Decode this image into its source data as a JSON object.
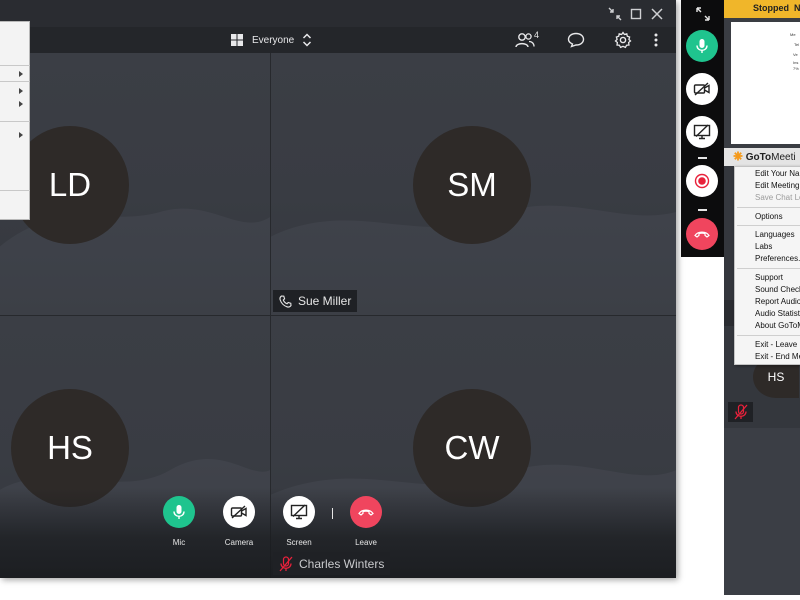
{
  "toolbar": {
    "view_label": "Everyone",
    "participant_count": "4"
  },
  "participants": [
    {
      "initials": "LD",
      "name": ""
    },
    {
      "initials": "SM",
      "name": "Sue Miller"
    },
    {
      "initials": "HS",
      "name": ""
    },
    {
      "initials": "CW",
      "name": "Charles Winters"
    }
  ],
  "controls": {
    "mic": "Mic",
    "camera": "Camera",
    "screen": "Screen",
    "leave": "Leave"
  },
  "colors": {
    "mic_active": "#1fc48e",
    "leave": "#f0455e",
    "record": "#e8213b",
    "status_bar": "#f0b62a",
    "logo_accent": "#f59a1b"
  },
  "goto": {
    "status": "Stopped",
    "status_extra": "N",
    "app_name_prefix": "GoTo",
    "app_name_suffix": "Meeti",
    "menu": [
      {
        "label": "Edit Your Na",
        "disabled": false
      },
      {
        "label": "Edit Meeting",
        "disabled": false
      },
      {
        "label": "Save Chat Lo",
        "disabled": true
      },
      {
        "label": "Options",
        "disabled": false
      },
      {
        "label": "Languages",
        "disabled": false
      },
      {
        "label": "Labs",
        "disabled": false
      },
      {
        "label": "Preferences...",
        "disabled": false
      },
      {
        "label": "Support",
        "disabled": false
      },
      {
        "label": "Sound Check",
        "disabled": false
      },
      {
        "label": "Report Audio",
        "disabled": false
      },
      {
        "label": "Audio Statist",
        "disabled": false
      },
      {
        "label": "About GoToM",
        "disabled": false
      },
      {
        "label": "Exit - Leave M",
        "disabled": false
      },
      {
        "label": "Exit - End Me",
        "disabled": false
      }
    ],
    "thumb_initials": "HS",
    "slide_lines": [
      "Me",
      "Tel",
      "Ve",
      "Ins",
      "7%"
    ]
  }
}
